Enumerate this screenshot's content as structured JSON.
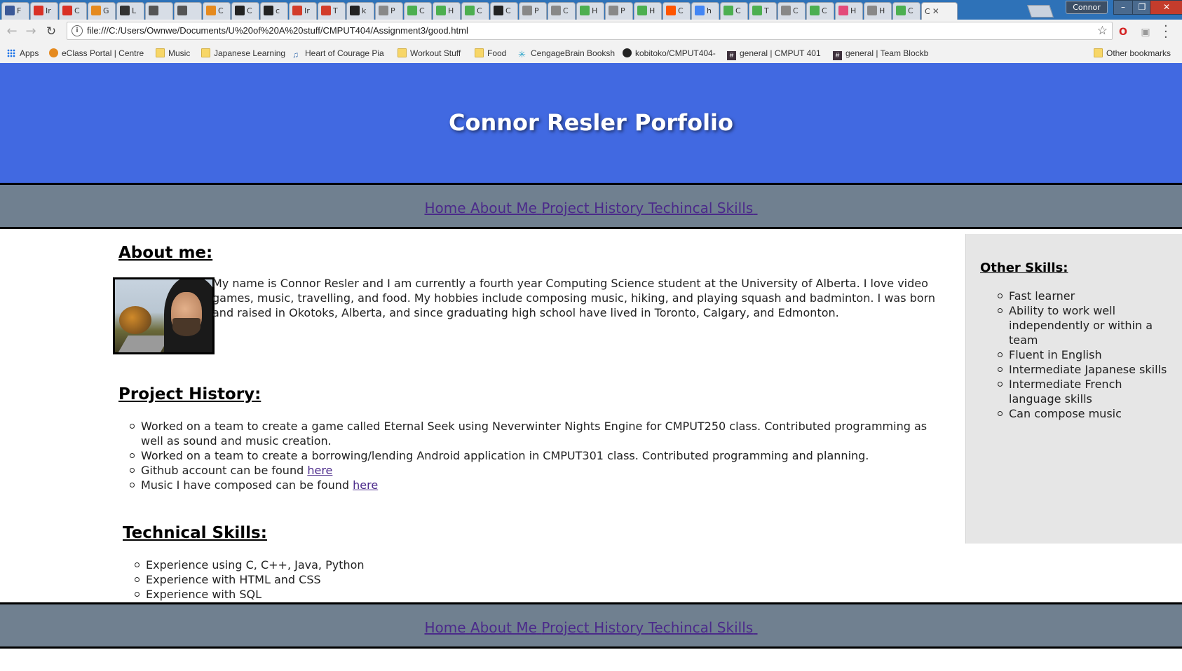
{
  "browser": {
    "tabs": [
      {
        "short": "F",
        "icon": "facebook-icon",
        "color": "#3b5998"
      },
      {
        "short": "Ir",
        "icon": "gmail-icon",
        "color": "#d93025"
      },
      {
        "short": "C",
        "icon": "gmail-icon",
        "color": "#d93025"
      },
      {
        "short": "G",
        "icon": "eclass-icon",
        "color": "#e58a1f"
      },
      {
        "short": "L",
        "icon": "shield-icon",
        "color": "#333333"
      },
      {
        "short": "",
        "icon": "play-icon",
        "color": "#555555"
      },
      {
        "short": "",
        "icon": "audio-icon",
        "color": "#555555"
      },
      {
        "short": "C",
        "icon": "eclass-icon",
        "color": "#e58a1f"
      },
      {
        "short": "C",
        "icon": "github-icon",
        "color": "#222222"
      },
      {
        "short": "c",
        "icon": "github-icon",
        "color": "#222222"
      },
      {
        "short": "Ir",
        "icon": "red-tile-icon",
        "color": "#d23c2a"
      },
      {
        "short": "T",
        "icon": "red-tile-icon",
        "color": "#d23c2a"
      },
      {
        "short": "k",
        "icon": "github-icon",
        "color": "#222222"
      },
      {
        "short": "P",
        "icon": "document-icon",
        "color": "#888888"
      },
      {
        "short": "C",
        "icon": "w3schools-icon",
        "color": "#4caf50"
      },
      {
        "short": "H",
        "icon": "w3schools-icon",
        "color": "#4caf50"
      },
      {
        "short": "C",
        "icon": "w3schools-icon",
        "color": "#4caf50"
      },
      {
        "short": "C",
        "icon": "github-icon",
        "color": "#222222"
      },
      {
        "short": "P",
        "icon": "document-icon",
        "color": "#888888"
      },
      {
        "short": "C",
        "icon": "document-icon",
        "color": "#888888"
      },
      {
        "short": "H",
        "icon": "w3schools-icon",
        "color": "#4caf50"
      },
      {
        "short": "P",
        "icon": "document-icon",
        "color": "#888888"
      },
      {
        "short": "H",
        "icon": "w3schools-icon",
        "color": "#4caf50"
      },
      {
        "short": "C",
        "icon": "soundcloud-icon",
        "color": "#ff5500"
      },
      {
        "short": "h",
        "icon": "google-icon",
        "color": "#4285f4"
      },
      {
        "short": "C",
        "icon": "w3schools-icon",
        "color": "#4caf50"
      },
      {
        "short": "T",
        "icon": "w3schools-icon",
        "color": "#4caf50"
      },
      {
        "short": "C",
        "icon": "document-icon",
        "color": "#888888"
      },
      {
        "short": "C",
        "icon": "w3schools-icon",
        "color": "#4caf50"
      },
      {
        "short": "H",
        "icon": "colorful-icon",
        "color": "#e34a7a"
      },
      {
        "short": "H",
        "icon": "document-icon",
        "color": "#888888"
      },
      {
        "short": "C",
        "icon": "w3schools-icon",
        "color": "#4caf50"
      }
    ],
    "active_tab": {
      "short": "C"
    },
    "profile_name": "Connor",
    "url": "file:///C:/Users/Ownwe/Documents/U%20of%20A%20stuff/CMPUT404/Assignment3/good.html",
    "bookmarks": [
      {
        "label": "Apps",
        "icon": "apps-icon"
      },
      {
        "label": "eClass Portal | Centre",
        "icon": "eclass-icon"
      },
      {
        "label": "Music",
        "icon": "folder-icon"
      },
      {
        "label": "Japanese Learning",
        "icon": "folder-icon"
      },
      {
        "label": "Heart of Courage Pia",
        "icon": "music-note-icon"
      },
      {
        "label": "Workout Stuff",
        "icon": "folder-icon"
      },
      {
        "label": "Food",
        "icon": "folder-icon"
      },
      {
        "label": "CengageBrain Booksh",
        "icon": "cengage-icon"
      },
      {
        "label": "kobitoko/CMPUT404-",
        "icon": "github-icon"
      },
      {
        "label": "general | CMPUT 401",
        "icon": "slack-icon"
      },
      {
        "label": "general | Team Blockb",
        "icon": "slack-icon"
      }
    ],
    "other_bookmarks": "Other bookmarks"
  },
  "header": {
    "title": "Connor Resler Porfolio",
    "bg_color": "#4169e1"
  },
  "nav": {
    "links": [
      "Home",
      "About Me",
      "Project History",
      "Techincal Skills"
    ],
    "bg_color": "#708090",
    "link_color": "#4b2a8a"
  },
  "about": {
    "heading": "About me:",
    "text": "My name is Connor Resler and I am currently a fourth year Computing Science student at the University of Alberta. I love video games, music, travelling, and food. My hobbies include composing music, hiking, and playing squash and badminton. I was born and raised in Okotoks, Alberta, and since graduating high school have lived in Toronto, Calgary, and Edmonton."
  },
  "projects": {
    "heading": "Project History:",
    "items": [
      "Worked on a team to create a game called Eternal Seek using Neverwinter Nights Engine for CMPUT250 class. Contributed programming as well as sound and music creation.",
      "Worked on a team to create a borrowing/lending Android application in CMPUT301 class. Contributed programming and planning."
    ],
    "github_prefix": "Github account can be found ",
    "music_prefix": "Music I have composed can be found ",
    "link_text": "here"
  },
  "tech": {
    "heading": "Technical Skills:",
    "items": [
      "Experience using C, C++, Java, Python",
      "Experience with HTML and CSS",
      "Experience with SQL"
    ]
  },
  "sidebar": {
    "heading": "Other Skills:",
    "items": [
      "Fast learner",
      "Ability to work well independently or within a team",
      "Fluent in English",
      "Intermediate Japanese skills",
      "Intermediate French language skills",
      "Can compose music"
    ],
    "bg_color": "#e6e6e6"
  }
}
